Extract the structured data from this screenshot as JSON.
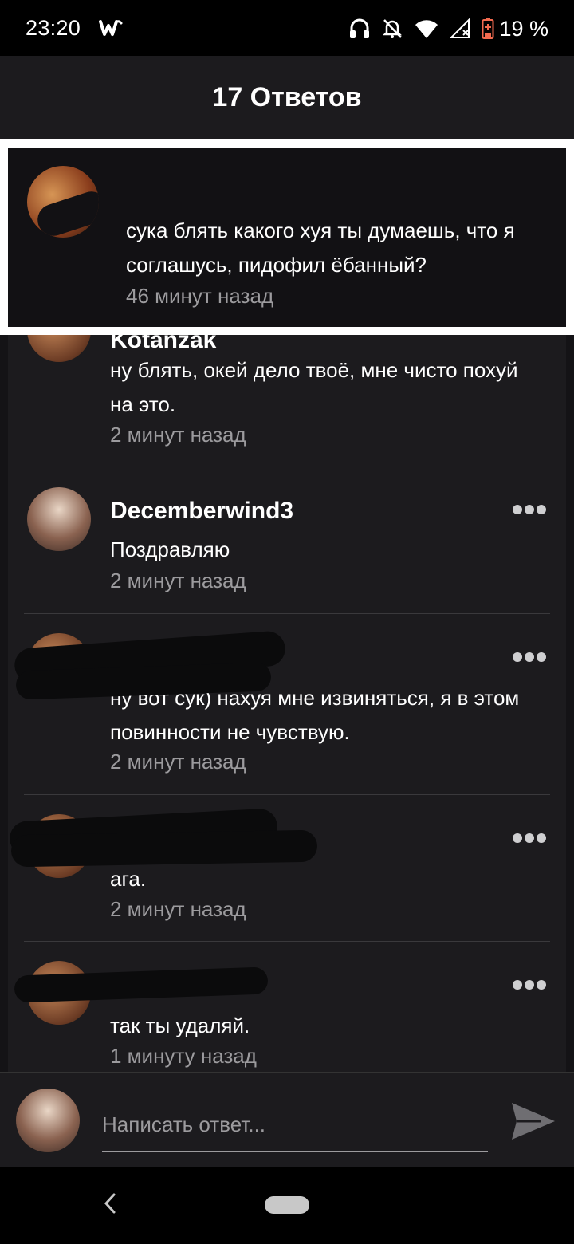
{
  "status_bar": {
    "time": "23:20",
    "battery": "19 %",
    "icons": [
      "wattpad-w-icon",
      "headphones-icon",
      "notifications-off-icon",
      "wifi-icon",
      "cell-signal-icon",
      "battery-low-icon"
    ]
  },
  "header": {
    "title": "17 Ответов"
  },
  "parent_comment": {
    "text": "сука блять какого хуя ты думаешь, что я соглашусь, пидофил ёбанный?",
    "time": "46 минут назад"
  },
  "comments": [
    {
      "username": "Kotanzak",
      "text": "ну блять, окей дело твоё, мне чисто похуй на это.",
      "time": "2 минут назад",
      "redacted": false
    },
    {
      "username": "Decemberwind3",
      "text": "Поздравляю",
      "time": "2 минут назад",
      "redacted": false
    },
    {
      "username": "",
      "text": "ну вот сук) нахуя мне извиняться, я в этом повинности не чувствую.",
      "time": "2 минут назад",
      "redacted": true
    },
    {
      "username": "",
      "text": "ага.",
      "time": "2 минут назад",
      "redacted": true
    },
    {
      "username": "",
      "text": "так ты удаляй.",
      "time": "1 минуту назад",
      "redacted": true
    }
  ],
  "reply": {
    "placeholder": "Написать ответ..."
  },
  "colors": {
    "background": "#1c1b1e",
    "card": "#121114",
    "muted_text": "#9c9b9e",
    "highlight_frame": "#ffffff"
  }
}
